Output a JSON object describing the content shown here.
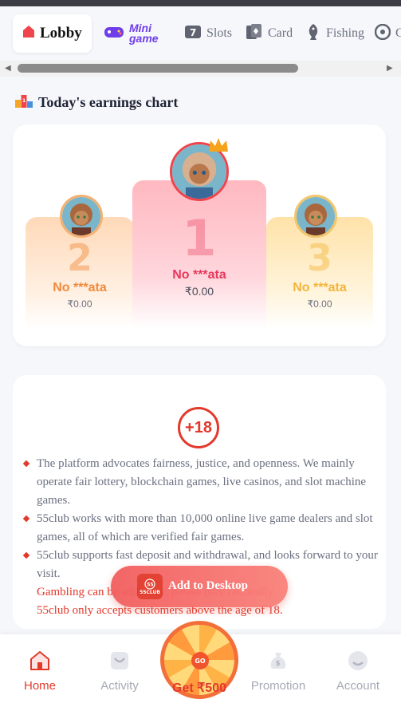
{
  "tabs": [
    {
      "label": "Lobby",
      "icon": "home-icon",
      "active": true
    },
    {
      "label": "Mini game",
      "icon": "gamepad-icon"
    },
    {
      "label": "Slots",
      "icon": "slot-7-icon"
    },
    {
      "label": "Card",
      "icon": "card-icon"
    },
    {
      "label": "Fishing",
      "icon": "fishing-icon"
    },
    {
      "label": "C",
      "icon": "casino-icon"
    }
  ],
  "section": {
    "title": "Today's earnings chart",
    "icon": "podium-icon"
  },
  "podium": [
    {
      "rank": "2",
      "name": "No ***ata",
      "amount": "₹0.00"
    },
    {
      "rank": "1",
      "name": "No ***ata",
      "amount": "₹0.00"
    },
    {
      "rank": "3",
      "name": "No ***ata",
      "amount": "₹0.00"
    }
  ],
  "info": {
    "age_badge": "+18",
    "rules": [
      "The platform advocates fairness, justice, and openness. We mainly operate fair lottery, blockchain games, live casinos, and slot machine games.",
      "55club works with more than 10,000 online live game dealers and slot games, all of which are verified fair games.",
      "55club supports fast deposit and withdrawal, and looks forward to your visit."
    ],
    "warning_line1": "Gambling can be addictive, please play rationally.",
    "warning_line2": "55club only accepts customers above the age of 18."
  },
  "add_desktop": {
    "label": "Add to Desktop",
    "logo_text": "55CLUB"
  },
  "bottom_nav": [
    {
      "label": "Home",
      "icon": "home-icon",
      "active": true
    },
    {
      "label": "Activity",
      "icon": "gift-icon"
    },
    {
      "label": "Promotion",
      "icon": "money-bag-icon"
    },
    {
      "label": "Account",
      "icon": "account-icon"
    }
  ],
  "wheel": {
    "hub_text": "GO",
    "label": "Get ₹500"
  },
  "colors": {
    "accent": "#e2392b",
    "rank2": "#f08a3a",
    "rank1": "#e8385b",
    "rank3": "#f2b53a"
  }
}
